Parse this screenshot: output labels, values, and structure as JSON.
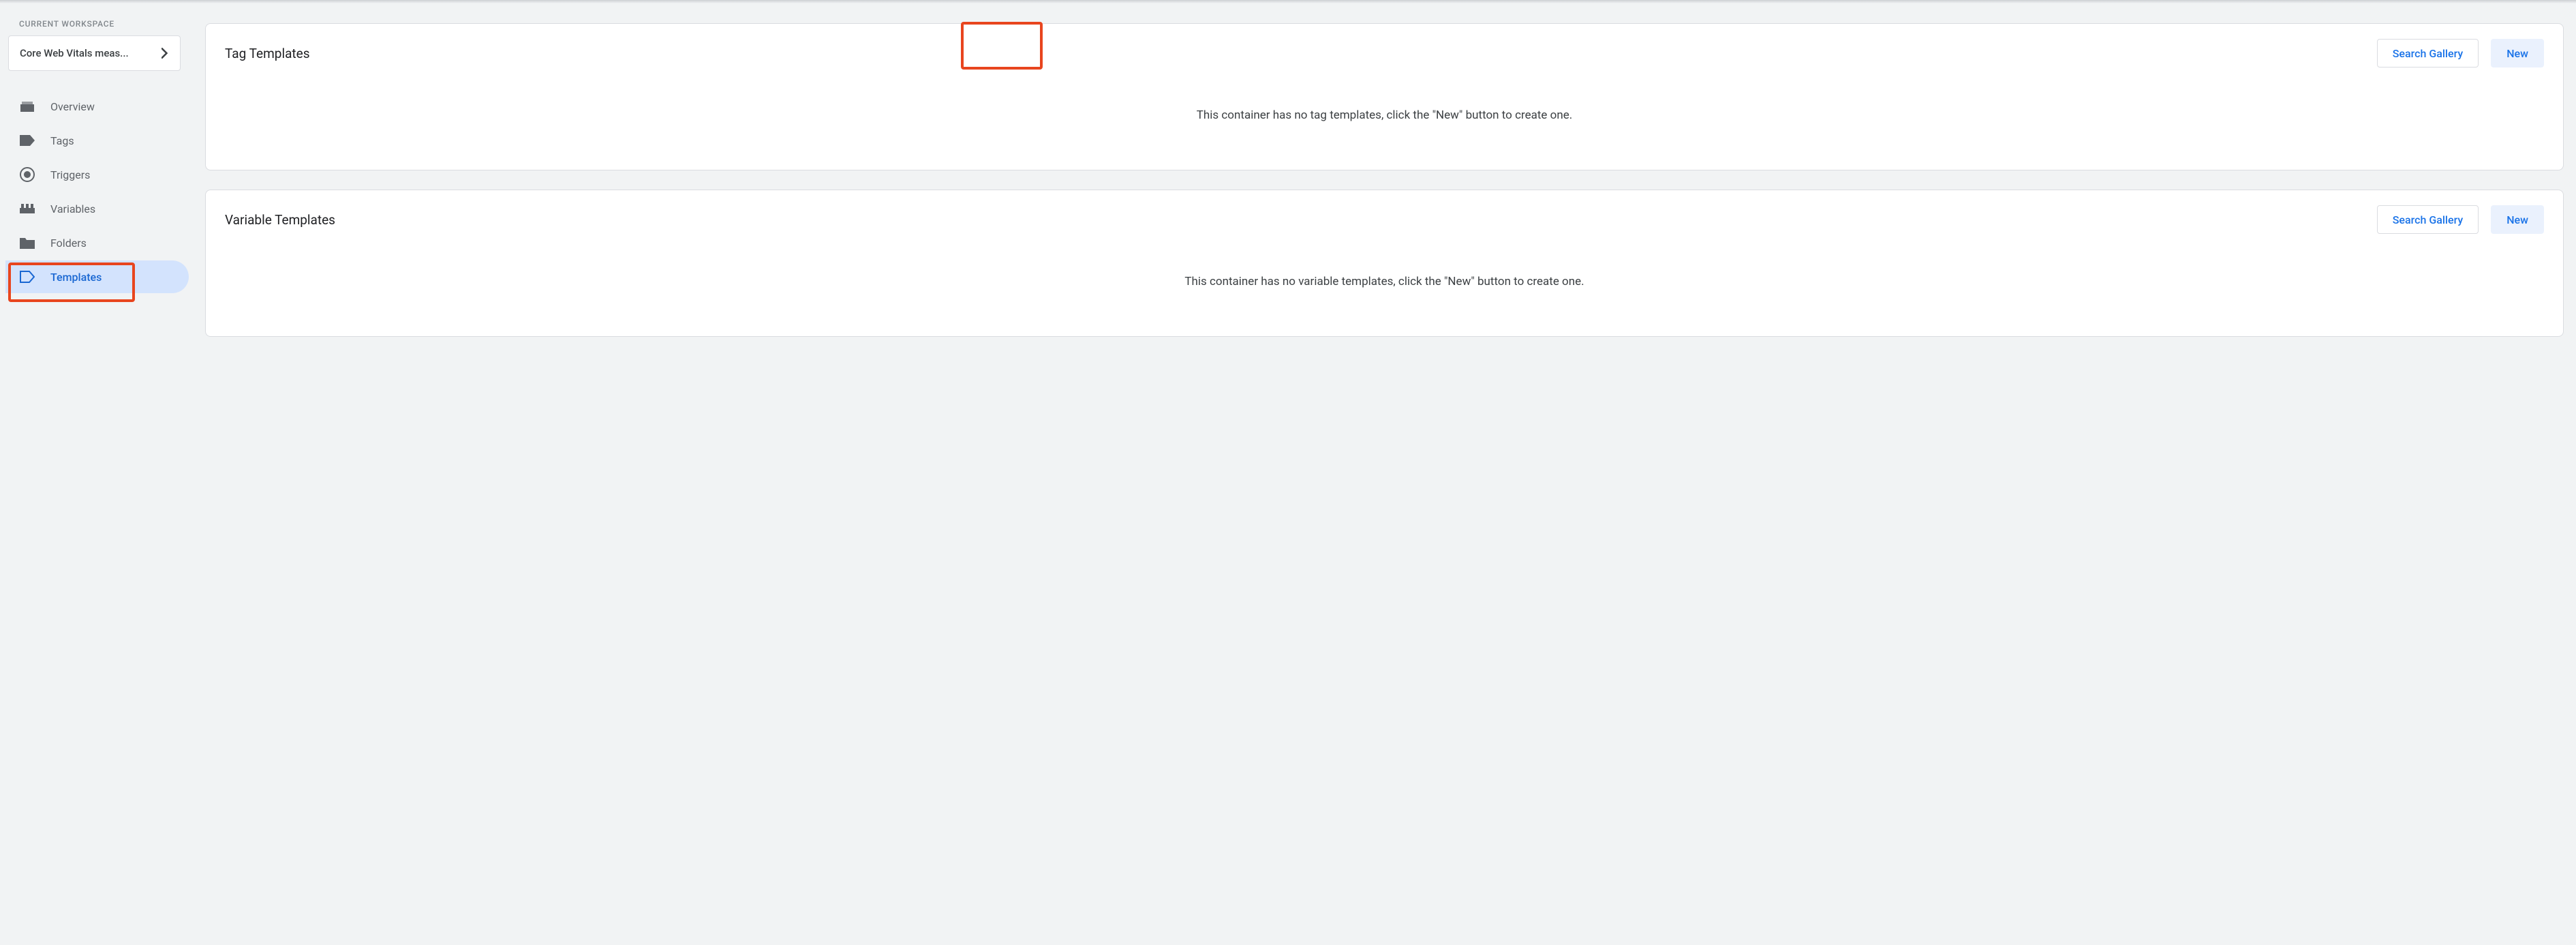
{
  "sidebar": {
    "workspace_label": "CURRENT WORKSPACE",
    "workspace_name": "Core Web Vitals meas...",
    "items": [
      {
        "label": "Overview"
      },
      {
        "label": "Tags"
      },
      {
        "label": "Triggers"
      },
      {
        "label": "Variables"
      },
      {
        "label": "Folders"
      },
      {
        "label": "Templates"
      }
    ],
    "active_index": 5
  },
  "cards": {
    "tag": {
      "title": "Tag Templates",
      "search_label": "Search Gallery",
      "new_label": "New",
      "empty_text": "This container has no tag templates, click the \"New\" button to create one."
    },
    "variable": {
      "title": "Variable Templates",
      "search_label": "Search Gallery",
      "new_label": "New",
      "empty_text": "This container has no variable templates, click the \"New\" button to create one."
    }
  }
}
